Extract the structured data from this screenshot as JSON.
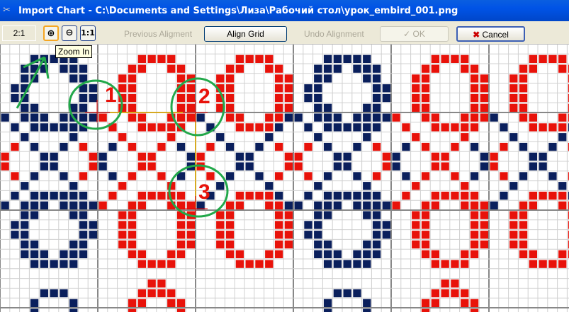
{
  "window": {
    "title": "Import Chart - C:\\Documents and Settings\\Лиза\\Рабочий стол\\урок_embird_001.png",
    "icon": "embird-app-icon"
  },
  "toolbar": {
    "zoom_level": "2:1",
    "zoom_in_label": "⊕",
    "zoom_out_label": "⊖",
    "actual_size_label": "1:1",
    "previous_alignment": "Previous Aligment",
    "align_grid": "Align Grid",
    "undo_alignment": "Undo Alignment",
    "ok": "✓ OK",
    "cancel": "Cancel",
    "cancel_icon": "✖"
  },
  "tooltip": {
    "text": "Zoom In"
  },
  "annotations": {
    "markers": [
      "1",
      "2",
      "3"
    ]
  },
  "colors": {
    "blue": "#0a1f5c",
    "red": "#e8120a",
    "grid_minor": "#d0d0d0",
    "grid_major": "#888888",
    "annotation": "#22a84a"
  }
}
